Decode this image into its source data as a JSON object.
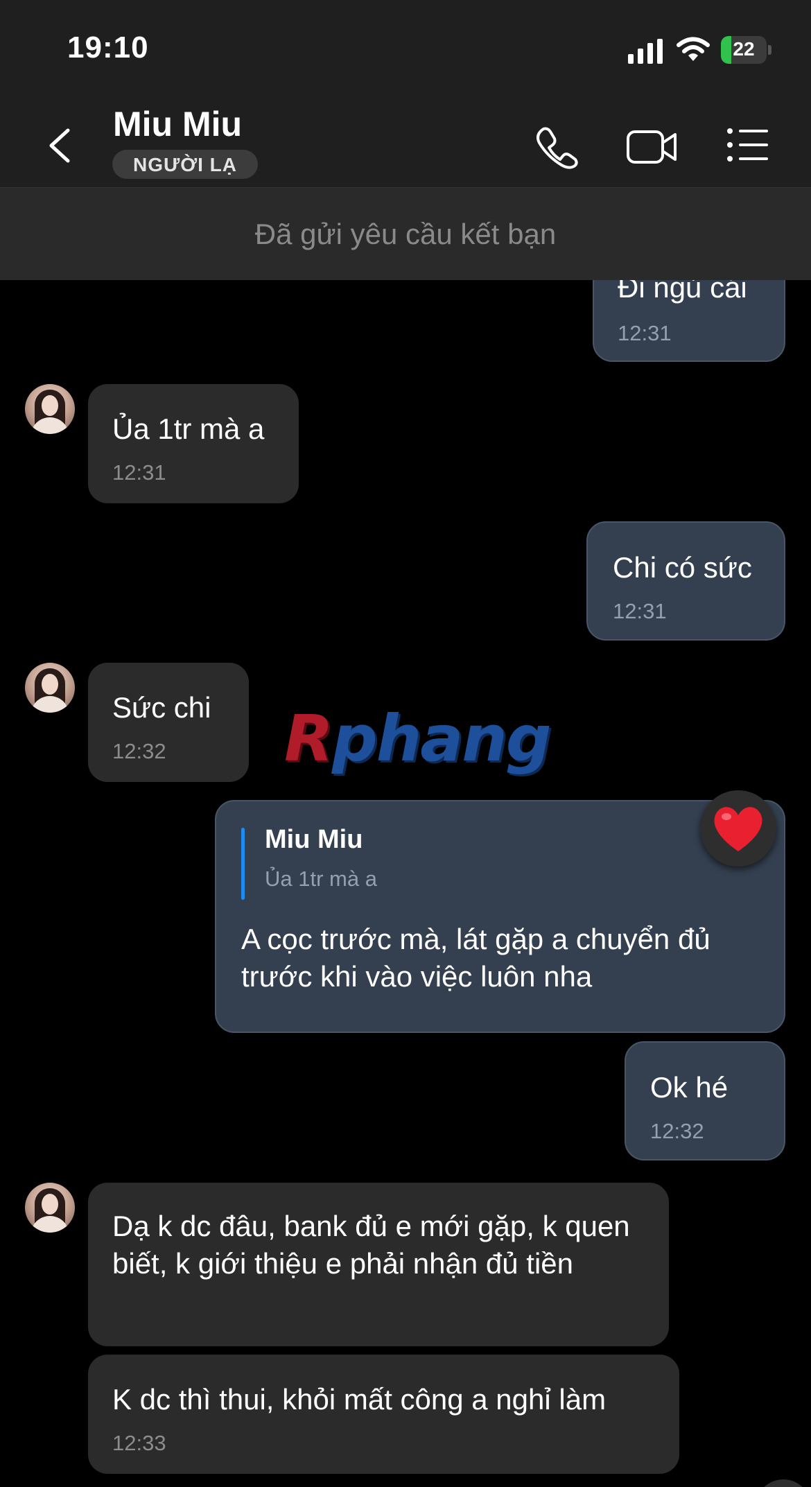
{
  "status_bar": {
    "time": "19:10",
    "battery": "22",
    "battery_level": 0.22
  },
  "header": {
    "contact_name": "Miu Miu",
    "badge": "NGƯỜI LẠ"
  },
  "notice": "Đã gửi yêu cầu kết bạn",
  "messages": [
    {
      "direction": "out",
      "text": "Đi ngủ cái",
      "time": "12:31"
    },
    {
      "direction": "in",
      "text": "Ủa 1tr mà a",
      "time": "12:31"
    },
    {
      "direction": "out",
      "text": "Chi có sức",
      "time": "12:31"
    },
    {
      "direction": "in",
      "text": "Sức chi",
      "time": "12:32"
    },
    {
      "direction": "out",
      "quote": {
        "name": "Miu Miu",
        "text": "Ủa 1tr mà a"
      },
      "text": "A cọc trước mà, lát gặp a chuyển đủ trước khi vào việc luôn nha",
      "reaction": "heart"
    },
    {
      "direction": "out",
      "text": "Ok hé",
      "time": "12:32"
    },
    {
      "direction": "in",
      "text": "Dạ k dc đâu, bank đủ e mới gặp, k quen biết, k giới thiệu e phải nhận đủ tiền"
    },
    {
      "direction": "in",
      "text": "K dc thì thui, khỏi mất công a nghỉ làm",
      "time": "12:33"
    }
  ],
  "watermark": {
    "first": "R",
    "rest": "phang"
  },
  "icons": {
    "back": "chevron-left-icon",
    "call": "phone-icon",
    "video": "video-camera-icon",
    "menu": "list-menu-icon",
    "reaction": "heart-icon"
  },
  "colors": {
    "bubble_in": "#2b2b2b",
    "bubble_out": "#344050",
    "quote_bar": "#1e8cf0",
    "heart": "#e8202f"
  }
}
